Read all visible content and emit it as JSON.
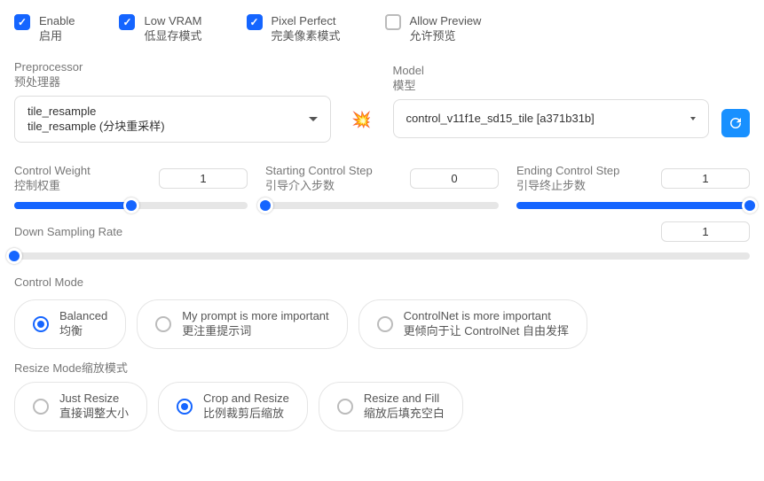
{
  "checkboxes": {
    "enable": {
      "en": "Enable",
      "zh": "启用",
      "checked": true
    },
    "lowvram": {
      "en": "Low VRAM",
      "zh": "低显存模式",
      "checked": true
    },
    "pixel": {
      "en": "Pixel Perfect",
      "zh": "完美像素模式",
      "checked": true
    },
    "preview": {
      "en": "Allow Preview",
      "zh": "允许预览",
      "checked": false
    }
  },
  "preproc": {
    "label_en": "Preprocessor",
    "label_zh": "预处理器",
    "value_en": "tile_resample",
    "value_zh": "tile_resample (分块重采样)"
  },
  "model": {
    "label_en": "Model",
    "label_zh": "模型",
    "value": "control_v11f1e_sd15_tile [a371b31b]"
  },
  "sliders": {
    "weight": {
      "en": "Control Weight",
      "zh": "控制权重",
      "value": "1",
      "pct": 50
    },
    "start": {
      "en": "Starting Control Step",
      "zh": "引导介入步数",
      "value": "0",
      "pct": 0
    },
    "end": {
      "en": "Ending Control Step",
      "zh": "引导终止步数",
      "value": "1",
      "pct": 100
    },
    "down": {
      "title": "Down Sampling Rate",
      "value": "1",
      "pct": 0
    }
  },
  "control_mode": {
    "title": "Control Mode",
    "options": {
      "balanced": {
        "en": "Balanced",
        "zh": "均衡",
        "checked": true
      },
      "prompt": {
        "en": "My prompt is more important",
        "zh": "更注重提示词",
        "checked": false
      },
      "cnet": {
        "en": "ControlNet is more important",
        "zh": "更倾向于让 ControlNet 自由发挥",
        "checked": false
      }
    }
  },
  "resize_mode": {
    "title_en": "Resize Mode",
    "title_zh": "缩放模式",
    "options": {
      "just": {
        "en": "Just Resize",
        "zh": "直接调整大小",
        "checked": false
      },
      "crop": {
        "en": "Crop and Resize",
        "zh": "比例裁剪后缩放",
        "checked": true
      },
      "fill": {
        "en": "Resize and Fill",
        "zh": "缩放后填充空白",
        "checked": false
      }
    }
  },
  "boom_icon": "💥"
}
